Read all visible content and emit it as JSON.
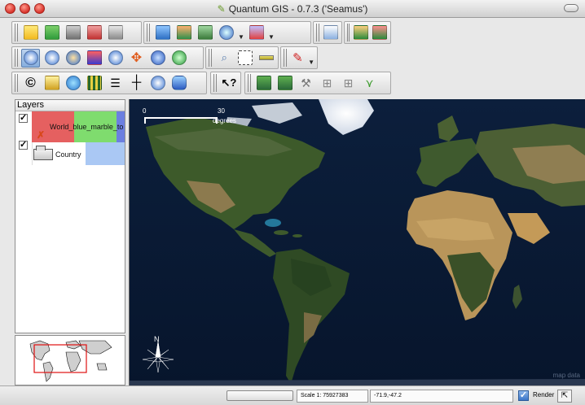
{
  "window": {
    "title": "Quantum GIS - 0.7.3 ('Seamus')"
  },
  "toolbars": {
    "file": [
      "new-project",
      "open-project",
      "save-project",
      "save-project-as",
      "print"
    ],
    "layers": [
      "add-vector-layer",
      "add-raster-layer",
      "add-postgis-layer",
      "capture-map-image",
      "remove-layer"
    ],
    "overview": [
      "overview-toggle"
    ],
    "plugins": [
      "plugin-manager",
      "python-plugin"
    ],
    "navigation": [
      "zoom-in",
      "zoom-out",
      "zoom-full",
      "zoom-to-selection",
      "zoom-to-layer",
      "pan",
      "zoom-last",
      "refresh"
    ],
    "attributes": [
      "identify",
      "select-features",
      "measure-line"
    ],
    "digitizing": [
      "draw-pencil"
    ],
    "row3": [
      "copyright-label",
      "north-arrow",
      "globe",
      "grid",
      "scale-bar",
      "add-point",
      "gps-tool",
      "layer-tool",
      "whats-this",
      "grass-region",
      "grass-display",
      "grass-tools",
      "grass-edit-1",
      "grass-edit-2",
      "grass-edit-3"
    ]
  },
  "layers_panel": {
    "title": "Layers",
    "items": [
      {
        "name": "World_blue_marble_to",
        "checked": true
      },
      {
        "name": "Country",
        "checked": true
      }
    ]
  },
  "map": {
    "scale_zero": "0",
    "scale_max": "30",
    "scale_unit": "degrees",
    "north_label": "N",
    "watermark": "map data"
  },
  "statusbar": {
    "scale_text": "Scale 1: 75927383",
    "coords": "-71.9,-47.2",
    "render_label": "Render",
    "render_checked": true
  }
}
